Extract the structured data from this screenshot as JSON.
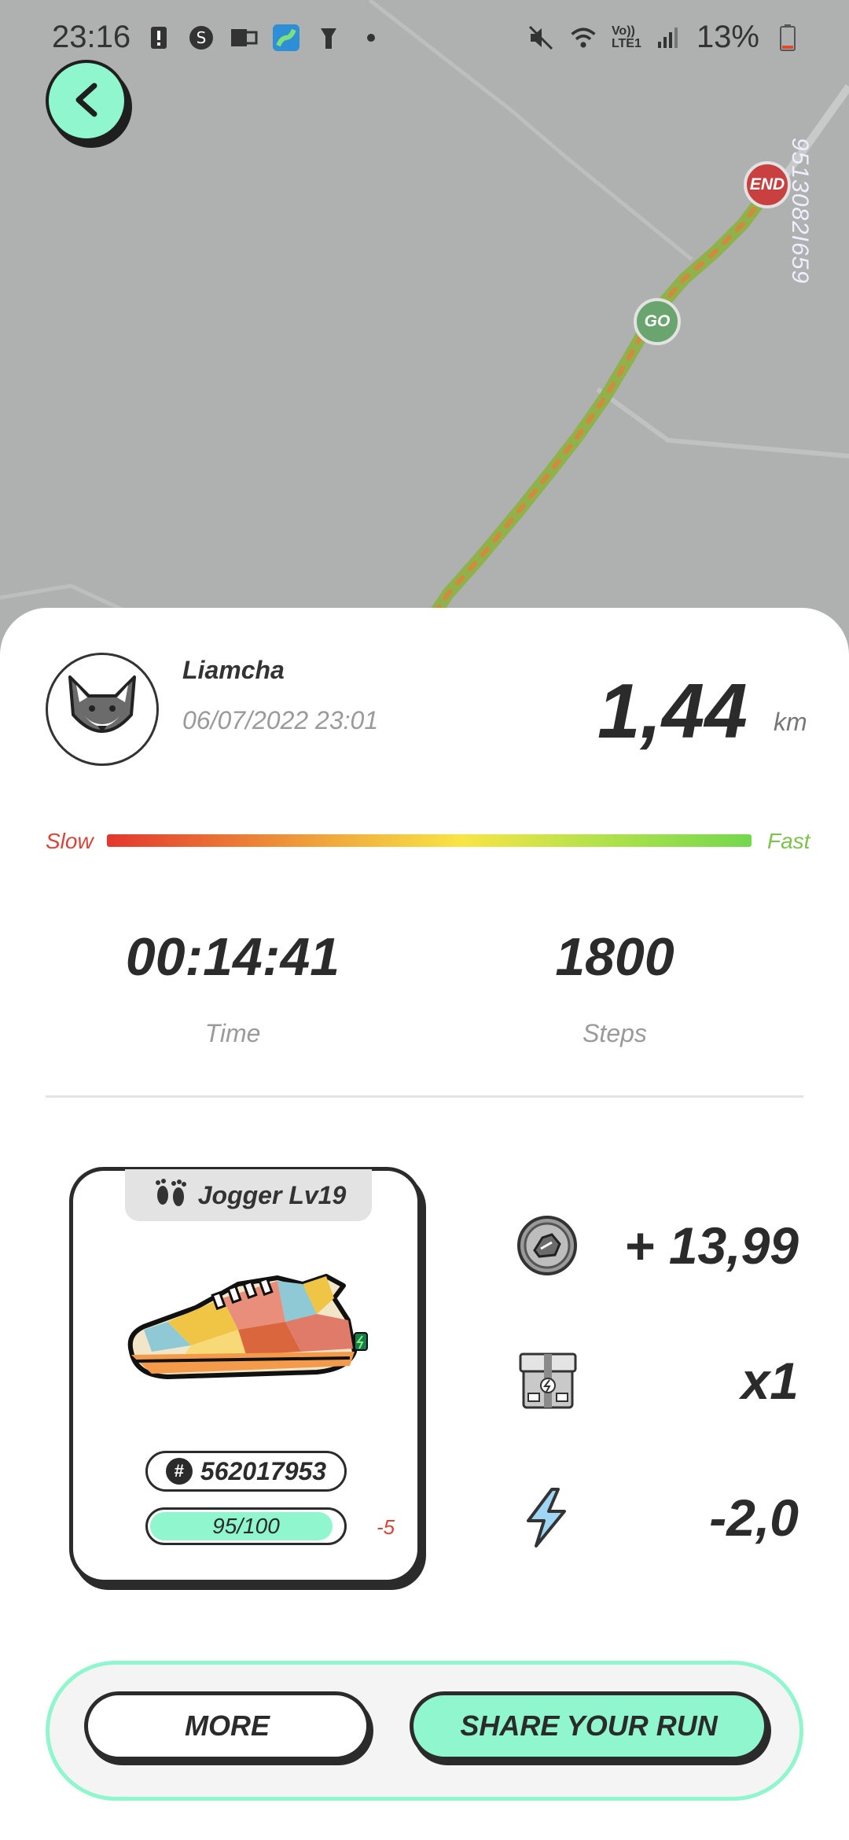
{
  "status_bar": {
    "time": "23:16",
    "battery_percent": "13%",
    "network_label": "Vo)) LTE1",
    "icons": [
      "alert-icon",
      "s-app-icon",
      "outlook-icon",
      "app-icon",
      "flashlight-icon",
      "dot-icon",
      "mute-icon",
      "wifi-icon",
      "signal-icon",
      "battery-icon"
    ]
  },
  "map": {
    "code": "9513082I659",
    "start_marker": "GO",
    "end_marker": "END"
  },
  "profile": {
    "username": "Liamcha",
    "datetime": "06/07/2022 23:01"
  },
  "run": {
    "distance": "1,44",
    "distance_unit": "km",
    "speed_scale": {
      "slow_label": "Slow",
      "fast_label": "Fast"
    },
    "time_value": "00:14:41",
    "time_label": "Time",
    "steps_value": "1800",
    "steps_label": "Steps"
  },
  "sneaker": {
    "tag": "Jogger Lv19",
    "id": "562017953",
    "hash_symbol": "#",
    "durability_text": "95/100",
    "durability_fraction": 0.95,
    "durability_change": "-5"
  },
  "rewards": {
    "gst": "+ 13,99",
    "box": "x1",
    "energy": "-2,0"
  },
  "actions": {
    "more": "MORE",
    "share": "SHARE YOUR RUN"
  },
  "colors": {
    "accent": "#8ff6ce",
    "map_bg": "#aeb1b0",
    "route_start": "#6aa46e",
    "route_end": "#c8403f",
    "slow": "#d8453a",
    "fast": "#7dc34b"
  }
}
